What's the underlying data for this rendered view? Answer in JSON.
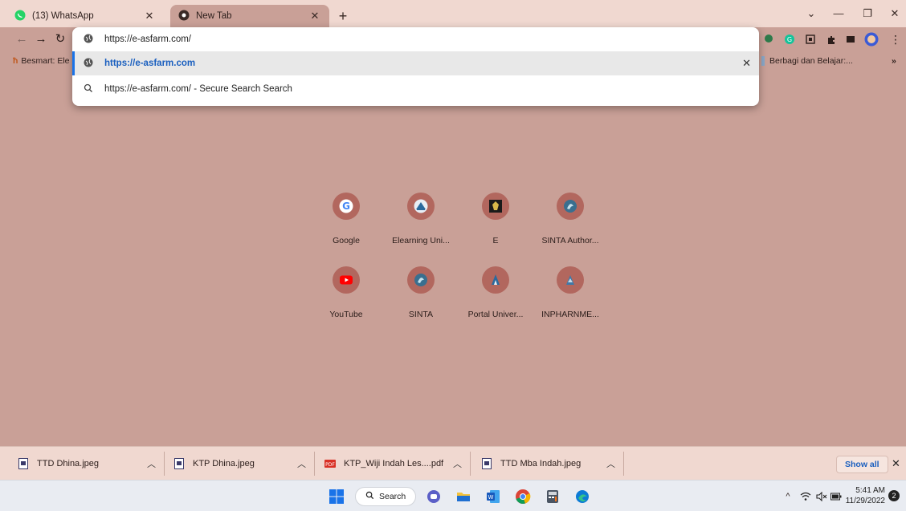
{
  "tabs": [
    {
      "title": "(13) WhatsApp",
      "icon": "whatsapp-icon"
    },
    {
      "title": "New Tab",
      "icon": "chrome-icon"
    }
  ],
  "omnibox": {
    "value": "https://e-asfarm.com/",
    "suggestions": [
      {
        "text": "https://e-asfarm.com",
        "icon": "globe-icon"
      },
      {
        "text": "https://e-asfarm.com/ - Secure Search Search",
        "icon": "search-icon"
      }
    ]
  },
  "bookmarks": [
    {
      "label": "Besmart: Ele"
    },
    {
      "label": "Berbagi dan Belajar:..."
    }
  ],
  "shortcuts": [
    {
      "label": "Google",
      "icon": "google-icon"
    },
    {
      "label": "Elearning Uni...",
      "icon": "elearning-icon"
    },
    {
      "label": "E",
      "icon": "emblem-icon"
    },
    {
      "label": "SINTA Author...",
      "icon": "sinta-icon"
    },
    {
      "label": "YouTube",
      "icon": "youtube-icon"
    },
    {
      "label": "SINTA",
      "icon": "sinta-icon"
    },
    {
      "label": "Portal Univer...",
      "icon": "university-icon"
    },
    {
      "label": "INPHARNME...",
      "icon": "university-icon"
    }
  ],
  "downloads": [
    {
      "name": "TTD Dhina.jpeg",
      "type": "image"
    },
    {
      "name": "KTP Dhina.jpeg",
      "type": "image"
    },
    {
      "name": "KTP_Wiji Indah Les....pdf",
      "type": "pdf"
    },
    {
      "name": "TTD Mba Indah.jpeg",
      "type": "image"
    }
  ],
  "shelf": {
    "show_all": "Show all"
  },
  "taskbar": {
    "search_label": "Search",
    "time": "5:41 AM",
    "date": "11/29/2022",
    "notifications": "2"
  },
  "colors": {
    "accent": "#1a73e8",
    "background": "#c9a097",
    "tile": "#b2675e"
  }
}
